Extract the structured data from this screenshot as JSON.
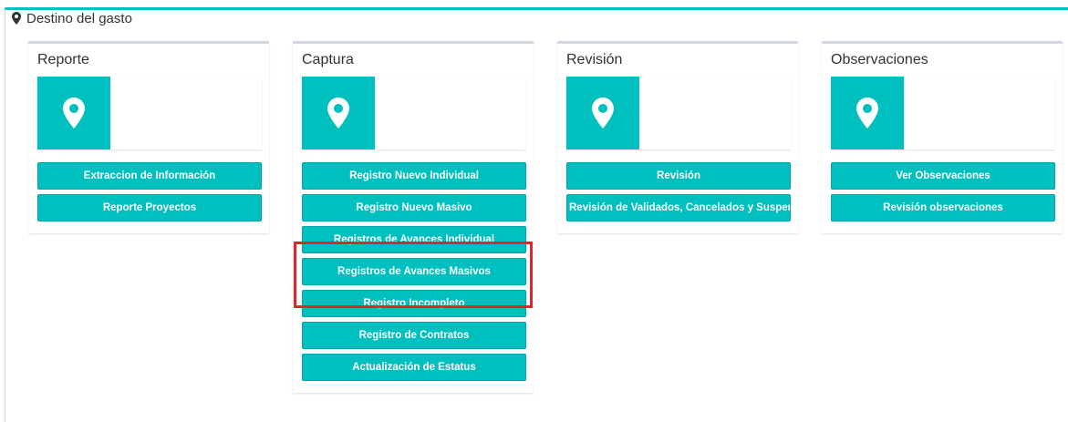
{
  "header": {
    "title": "Destino del gasto",
    "icon": "map-marker-icon"
  },
  "accent_color": "#00bfbf",
  "highlight_color": "#e0262b",
  "columns": [
    {
      "title": "Reporte",
      "buttons": [
        "Extraccion de Información",
        "Reporte Proyectos"
      ]
    },
    {
      "title": "Captura",
      "buttons": [
        "Registro Nuevo Individual",
        "Registro Nuevo Masivo",
        "Registros de Avances Individual",
        "Registros de Avances Masivos",
        "Registro Incompleto",
        "Registro de Contratos",
        "Actualización de Estatus"
      ]
    },
    {
      "title": "Revisión",
      "buttons": [
        "Revisión",
        "Revisión de Validados, Cancelados y Suspendidos"
      ]
    },
    {
      "title": "Observaciones",
      "buttons": [
        "Ver Observaciones",
        "Revisión observaciones"
      ]
    }
  ]
}
